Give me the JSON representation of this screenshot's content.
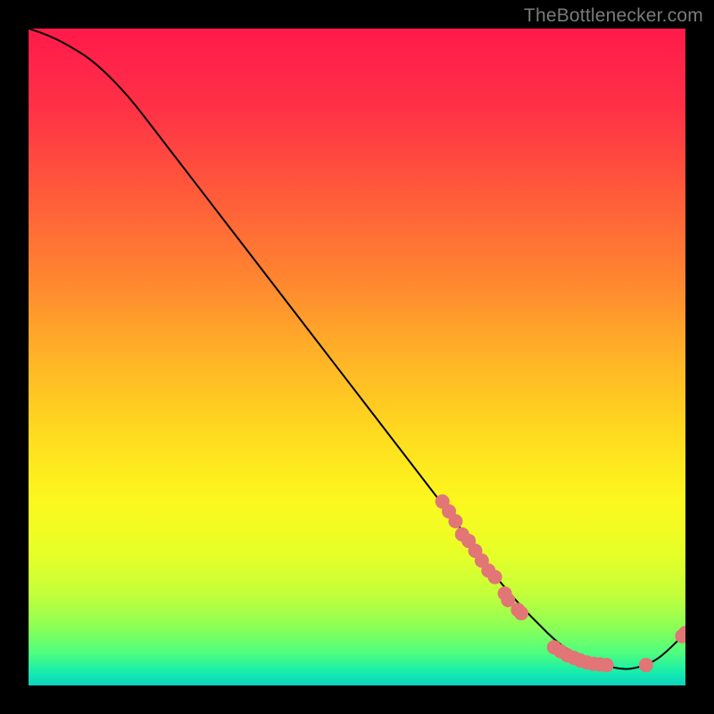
{
  "watermark": "TheBottlenecker.com",
  "chart_data": {
    "type": "line",
    "title": "",
    "xlabel": "",
    "ylabel": "",
    "xlim": [
      0,
      100
    ],
    "ylim": [
      0,
      100
    ],
    "grid": false,
    "series": [
      {
        "name": "curve",
        "color": "#000000",
        "x": [
          0,
          3,
          6,
          10,
          15,
          20,
          25,
          30,
          35,
          40,
          45,
          50,
          55,
          60,
          65,
          70,
          72,
          75,
          78,
          80,
          82,
          85,
          88,
          90,
          92,
          95,
          97,
          100
        ],
        "y": [
          100,
          99,
          97.5,
          95,
          90,
          83.5,
          77,
          70.5,
          64,
          57.5,
          51,
          44.5,
          38,
          31.5,
          25,
          18,
          15.5,
          12,
          9,
          7,
          5.5,
          4,
          3,
          2.5,
          2.5,
          3.5,
          5,
          8
        ]
      }
    ],
    "points": {
      "color": "#e27575",
      "radius_px": 8,
      "coords": [
        [
          63,
          28
        ],
        [
          64,
          26.5
        ],
        [
          65,
          25
        ],
        [
          66,
          23
        ],
        [
          67,
          22
        ],
        [
          68,
          20.5
        ],
        [
          69,
          19
        ],
        [
          70,
          17.5
        ],
        [
          71,
          16.5
        ],
        [
          72.5,
          14
        ],
        [
          73,
          13
        ],
        [
          74.5,
          11.5
        ],
        [
          75,
          11
        ],
        [
          80,
          5.8
        ],
        [
          81,
          5.2
        ],
        [
          82,
          4.6
        ],
        [
          83,
          4.2
        ],
        [
          84,
          3.8
        ],
        [
          85,
          3.5
        ],
        [
          86,
          3.3
        ],
        [
          87,
          3.2
        ],
        [
          88,
          3.1
        ],
        [
          94,
          3.1
        ],
        [
          99.5,
          7.5
        ],
        [
          100,
          8
        ]
      ]
    },
    "background_gradient": {
      "type": "rainbow-heat",
      "stops": [
        {
          "offset": 0.0,
          "color": "#ff1a4b"
        },
        {
          "offset": 0.12,
          "color": "#ff3146"
        },
        {
          "offset": 0.25,
          "color": "#ff5a3a"
        },
        {
          "offset": 0.38,
          "color": "#ff8530"
        },
        {
          "offset": 0.5,
          "color": "#ffb327"
        },
        {
          "offset": 0.62,
          "color": "#ffdb1f"
        },
        {
          "offset": 0.72,
          "color": "#fcf81e"
        },
        {
          "offset": 0.8,
          "color": "#e6ff28"
        },
        {
          "offset": 0.86,
          "color": "#c4ff3a"
        },
        {
          "offset": 0.91,
          "color": "#8dff55"
        },
        {
          "offset": 0.95,
          "color": "#4fff7e"
        },
        {
          "offset": 0.98,
          "color": "#16ecad"
        },
        {
          "offset": 1.0,
          "color": "#0cd2bf"
        }
      ]
    }
  }
}
